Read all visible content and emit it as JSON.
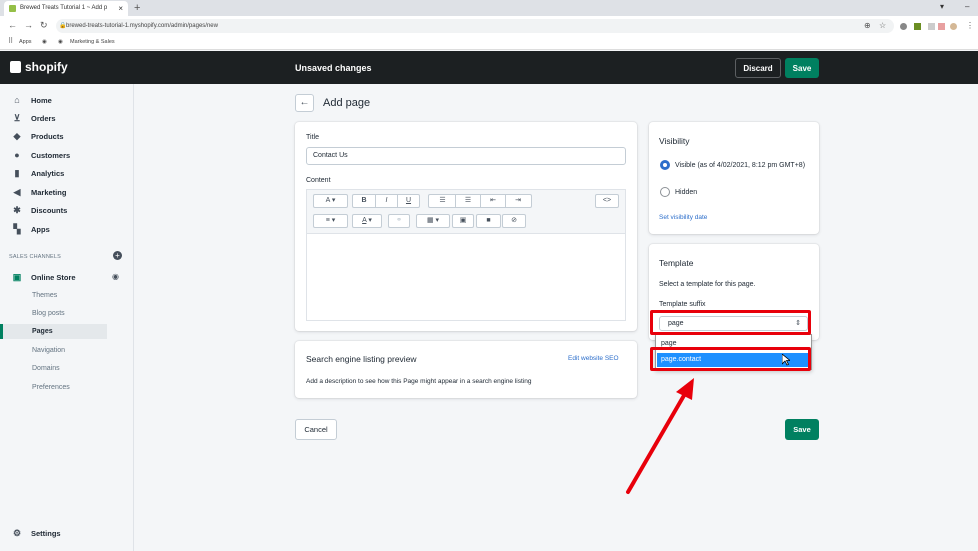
{
  "browser": {
    "tab_title": "Brewed Treats Tutorial 1 ~ Add p",
    "url": "brewed-treats-tutorial-1.myshopify.com/admin/pages/new",
    "bookmarks": [
      "Apps",
      "Marketing & Sales"
    ]
  },
  "topbar": {
    "logo": "shopify",
    "status": "Unsaved changes",
    "discard_label": "Discard",
    "save_label": "Save"
  },
  "sidebar": {
    "items": [
      {
        "label": "Home",
        "icon": "home-icon"
      },
      {
        "label": "Orders",
        "icon": "orders-icon"
      },
      {
        "label": "Products",
        "icon": "tag-icon"
      },
      {
        "label": "Customers",
        "icon": "person-icon"
      },
      {
        "label": "Analytics",
        "icon": "bar-chart-icon"
      },
      {
        "label": "Marketing",
        "icon": "megaphone-icon"
      },
      {
        "label": "Discounts",
        "icon": "discount-icon"
      },
      {
        "label": "Apps",
        "icon": "apps-icon"
      }
    ],
    "section_label": "SALES CHANNELS",
    "online_store": "Online Store",
    "sub_items": [
      "Themes",
      "Blog posts",
      "Pages",
      "Navigation",
      "Domains",
      "Preferences"
    ],
    "active_sub": "Pages",
    "settings": "Settings"
  },
  "page": {
    "title": "Add page",
    "title_label": "Title",
    "title_value": "Contact Us",
    "content_label": "Content"
  },
  "seo": {
    "title": "Search engine listing preview",
    "edit_link": "Edit website SEO",
    "description": "Add a description to see how this Page might appear in a search engine listing"
  },
  "visibility": {
    "title": "Visibility",
    "visible_label": "Visible (as of 4/02/2021, 8:12 pm GMT+8)",
    "hidden_label": "Hidden",
    "set_date_link": "Set visibility date"
  },
  "template": {
    "title": "Template",
    "description": "Select a template for this page.",
    "suffix_label": "Template suffix",
    "selected": "page",
    "options": [
      "page",
      "page.contact"
    ],
    "highlighted": "page.contact"
  },
  "actions": {
    "cancel_label": "Cancel",
    "save_label": "Save"
  },
  "colors": {
    "brand_green": "#008060",
    "highlight_red": "#e8000b",
    "selection_blue": "#1e90ff",
    "link_blue": "#2c6ecb"
  }
}
